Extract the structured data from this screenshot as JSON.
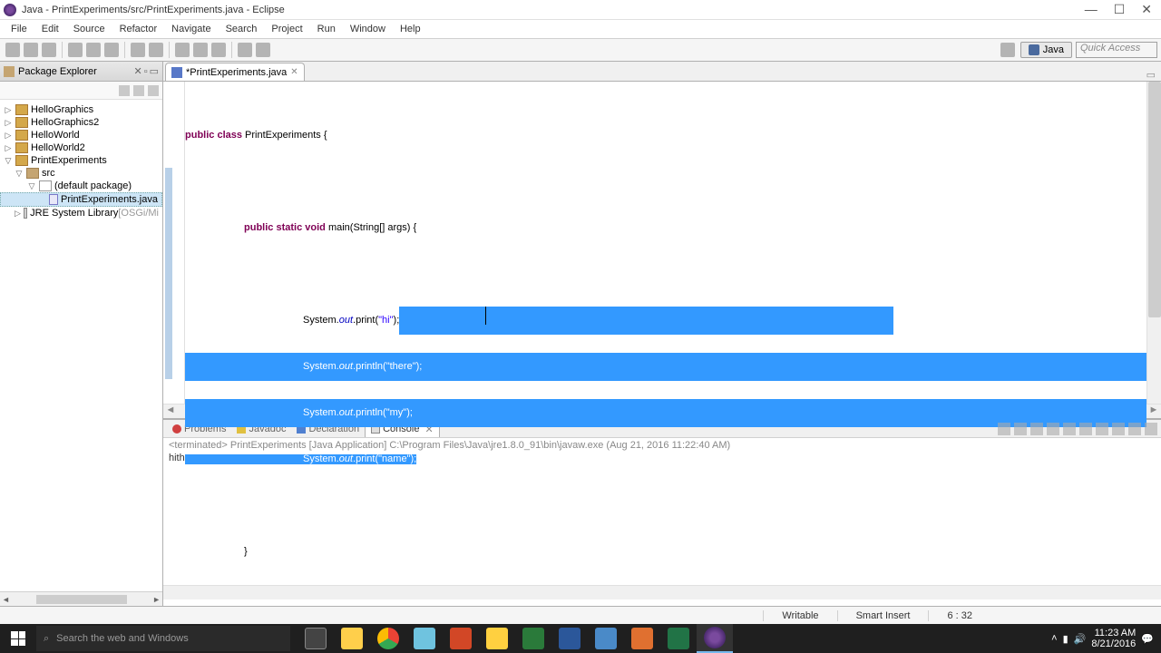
{
  "window": {
    "title": "Java - PrintExperiments/src/PrintExperiments.java - Eclipse"
  },
  "menu": [
    "File",
    "Edit",
    "Source",
    "Refactor",
    "Navigate",
    "Search",
    "Project",
    "Run",
    "Window",
    "Help"
  ],
  "perspective": {
    "label": "Java"
  },
  "quick_access": {
    "placeholder": "Quick Access"
  },
  "sidebar": {
    "title": "Package Explorer",
    "projects": [
      {
        "name": "HelloGraphics",
        "expanded": false
      },
      {
        "name": "HelloGraphics2",
        "expanded": false
      },
      {
        "name": "HelloWorld",
        "expanded": false
      },
      {
        "name": "HelloWorld2",
        "expanded": false
      },
      {
        "name": "PrintExperiments",
        "expanded": true
      }
    ],
    "src_label": "src",
    "pkg_label": "(default package)",
    "file_label": "PrintExperiments.java",
    "lib_label": "JRE System Library",
    "lib_suffix": " [OSGi/Mi"
  },
  "editor": {
    "tab_label": "*PrintExperiments.java",
    "code": {
      "l1a": "public",
      "l1b": " ",
      "l1c": "class",
      "l1d": " PrintExperiments {",
      "l2a": "public",
      "l2b": " ",
      "l2c": "static",
      "l2d": " ",
      "l2e": "void",
      "l2f": " main(String[] args) {",
      "l3a": "System.",
      "l3b": "out",
      "l3c": ".print(",
      "l3d": "\"hi\"",
      "l3e": ");",
      "l4a": "System.",
      "l4b": "out",
      "l4c": ".println(",
      "l4d": "\"there\"",
      "l4e": ");",
      "l5a": "System.",
      "l5b": "out",
      "l5c": ".println(",
      "l5d": "\"my\"",
      "l5e": ");",
      "l6a": "System.",
      "l6b": "out",
      "l6c": ".print(",
      "l6d": "\"name\"",
      "l6e": ");",
      "l7": "}"
    }
  },
  "bottom": {
    "tabs": [
      "Problems",
      "Javadoc",
      "Declaration",
      "Console"
    ],
    "console_status": "<terminated> PrintExperiments [Java Application] C:\\Program Files\\Java\\jre1.8.0_91\\bin\\javaw.exe (Aug 21, 2016 11:22:40 AM)",
    "console_output": "hithere"
  },
  "status": {
    "writable": "Writable",
    "insert": "Smart Insert",
    "pos": "6 : 32"
  },
  "taskbar": {
    "search_placeholder": "Search the web and Windows",
    "time": "11:23 AM",
    "date": "8/21/2016"
  }
}
